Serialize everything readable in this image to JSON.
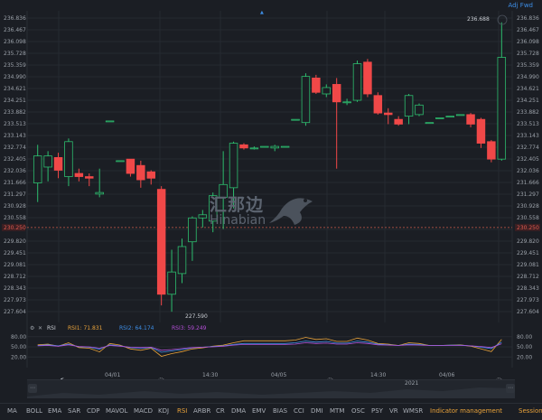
{
  "header": {
    "adj_label": "Adj Fwd",
    "marker_icon": "triangle-marker-icon"
  },
  "chart_data": {
    "type": "candlestick",
    "price_axis": {
      "min": 227.604,
      "max": 236.836,
      "ticks": [
        236.836,
        236.467,
        236.098,
        235.728,
        235.359,
        234.99,
        234.621,
        234.251,
        233.882,
        233.513,
        233.143,
        232.774,
        232.405,
        232.036,
        231.666,
        231.297,
        230.928,
        230.558,
        230.189,
        229.82,
        229.451,
        229.081,
        228.712,
        228.343,
        227.973,
        227.604
      ],
      "left_labels": [
        "236.836",
        "236.467",
        "236.098",
        "235.728",
        "235.359",
        "234.990",
        "234.621",
        "234.251",
        "233.882",
        "233.513",
        "233.143",
        "232.774",
        "232.405",
        "232.036",
        "231.666",
        "231.297",
        "230.928",
        "230.558",
        "",
        "229.820",
        "229.451",
        "229.081",
        "228.712",
        "228.343",
        "227.973",
        "227.604"
      ],
      "right_labels": [
        "236.836",
        "236.467",
        "236.098",
        "235.728",
        "235.359",
        "234.990",
        "234.621",
        "234.251",
        "233.882",
        "233.513",
        "233.143",
        "232.774",
        "232.405",
        "232.036",
        "231.666",
        "231.297",
        "230.928",
        "230.558",
        "",
        "229.820",
        "229.451",
        "229.081",
        "228.712",
        "228.343",
        "227.973",
        "227.604"
      ],
      "current_price": 230.25,
      "current_label": "230.250",
      "high_label": "236.688",
      "low_label": "227.590"
    },
    "candles": [
      {
        "o": 231.65,
        "h": 232.85,
        "l": 231.05,
        "c": 232.5
      },
      {
        "o": 232.15,
        "h": 232.65,
        "l": 231.7,
        "c": 232.5
      },
      {
        "o": 232.45,
        "h": 232.6,
        "l": 231.8,
        "c": 232.05
      },
      {
        "o": 231.85,
        "h": 233.05,
        "l": 231.55,
        "c": 232.95
      },
      {
        "o": 231.95,
        "h": 232.1,
        "l": 231.7,
        "c": 231.85
      },
      {
        "o": 231.85,
        "h": 231.95,
        "l": 231.55,
        "c": 231.8
      },
      {
        "o": 231.3,
        "h": 232.1,
        "l": 231.2,
        "c": 231.35
      },
      {
        "o": 233.6,
        "h": 233.6,
        "l": 233.6,
        "c": 233.6
      },
      {
        "o": 232.35,
        "h": 232.35,
        "l": 232.35,
        "c": 232.35
      },
      {
        "o": 232.4,
        "h": 232.4,
        "l": 231.85,
        "c": 231.95
      },
      {
        "o": 232.2,
        "h": 232.35,
        "l": 231.5,
        "c": 231.75
      },
      {
        "o": 232.0,
        "h": 232.05,
        "l": 231.6,
        "c": 231.8
      },
      {
        "o": 231.45,
        "h": 231.55,
        "l": 227.8,
        "c": 228.15
      },
      {
        "o": 228.15,
        "h": 229.55,
        "l": 227.6,
        "c": 228.85
      },
      {
        "o": 228.8,
        "h": 229.9,
        "l": 228.5,
        "c": 229.65
      },
      {
        "o": 229.8,
        "h": 230.6,
        "l": 229.2,
        "c": 230.55
      },
      {
        "o": 230.55,
        "h": 230.8,
        "l": 230.25,
        "c": 230.65
      },
      {
        "o": 230.45,
        "h": 231.35,
        "l": 230.1,
        "c": 231.25
      },
      {
        "o": 231.2,
        "h": 232.65,
        "l": 230.2,
        "c": 231.6
      },
      {
        "o": 231.5,
        "h": 232.95,
        "l": 230.85,
        "c": 232.9
      },
      {
        "o": 232.85,
        "h": 232.9,
        "l": 232.7,
        "c": 232.75
      },
      {
        "o": 232.75,
        "h": 232.8,
        "l": 232.7,
        "c": 232.75
      },
      {
        "o": 232.8,
        "h": 232.8,
        "l": 232.8,
        "c": 232.8
      },
      {
        "o": 232.75,
        "h": 232.85,
        "l": 232.65,
        "c": 232.8
      },
      {
        "o": 232.8,
        "h": 232.8,
        "l": 232.8,
        "c": 232.8
      },
      {
        "o": 233.65,
        "h": 233.65,
        "l": 233.65,
        "c": 233.65
      },
      {
        "o": 233.55,
        "h": 235.1,
        "l": 233.45,
        "c": 235.0
      },
      {
        "o": 234.95,
        "h": 235.05,
        "l": 234.45,
        "c": 234.5
      },
      {
        "o": 234.45,
        "h": 234.75,
        "l": 234.35,
        "c": 234.65
      },
      {
        "o": 234.75,
        "h": 234.95,
        "l": 232.1,
        "c": 234.2
      },
      {
        "o": 234.2,
        "h": 234.3,
        "l": 234.1,
        "c": 234.2
      },
      {
        "o": 234.25,
        "h": 235.5,
        "l": 234.2,
        "c": 235.4
      },
      {
        "o": 235.45,
        "h": 235.55,
        "l": 234.35,
        "c": 234.45
      },
      {
        "o": 234.4,
        "h": 234.5,
        "l": 233.8,
        "c": 233.85
      },
      {
        "o": 233.85,
        "h": 234.0,
        "l": 233.5,
        "c": 233.8
      },
      {
        "o": 233.65,
        "h": 233.75,
        "l": 233.45,
        "c": 233.5
      },
      {
        "o": 233.75,
        "h": 234.45,
        "l": 233.5,
        "c": 234.4
      },
      {
        "o": 233.8,
        "h": 234.15,
        "l": 233.75,
        "c": 234.1
      },
      {
        "o": 233.55,
        "h": 233.55,
        "l": 233.55,
        "c": 233.55
      },
      {
        "o": 233.7,
        "h": 233.7,
        "l": 233.7,
        "c": 233.7
      },
      {
        "o": 233.75,
        "h": 233.75,
        "l": 233.75,
        "c": 233.75
      },
      {
        "o": 233.8,
        "h": 233.8,
        "l": 233.8,
        "c": 233.8
      },
      {
        "o": 233.8,
        "h": 233.85,
        "l": 233.4,
        "c": 233.5
      },
      {
        "o": 233.65,
        "h": 233.7,
        "l": 232.75,
        "c": 232.9
      },
      {
        "o": 232.95,
        "h": 233.0,
        "l": 232.3,
        "c": 232.4
      },
      {
        "o": 232.4,
        "h": 236.7,
        "l": 232.35,
        "c": 235.6
      }
    ],
    "rsi": {
      "label": "RSI",
      "series": [
        {
          "name": "RSI1: 71.831",
          "color": "#e8a23a",
          "values": [
            56,
            58,
            52,
            62,
            48,
            46,
            35,
            60,
            55,
            44,
            40,
            46,
            22,
            30,
            36,
            44,
            47,
            52,
            55,
            62,
            68,
            68,
            68,
            68,
            68,
            70,
            78,
            72,
            74,
            66,
            66,
            76,
            70,
            60,
            58,
            54,
            62,
            60,
            54,
            54,
            55,
            56,
            52,
            44,
            36,
            72
          ]
        },
        {
          "name": "RSI2: 64.174",
          "color": "#3d8ee6",
          "values": [
            54,
            56,
            53,
            58,
            50,
            49,
            43,
            56,
            53,
            48,
            46,
            48,
            34,
            38,
            42,
            47,
            49,
            51,
            53,
            57,
            60,
            60,
            60,
            60,
            60,
            62,
            67,
            64,
            66,
            61,
            61,
            67,
            64,
            58,
            56,
            54,
            58,
            57,
            54,
            54,
            55,
            55,
            53,
            49,
            45,
            64
          ]
        },
        {
          "name": "RSI3: 59.249",
          "color": "#b34fd6",
          "values": [
            53,
            54,
            52,
            56,
            51,
            50,
            46,
            54,
            52,
            49,
            48,
            49,
            40,
            42,
            45,
            48,
            49,
            50,
            52,
            55,
            57,
            57,
            57,
            57,
            57,
            58,
            62,
            60,
            61,
            58,
            58,
            62,
            60,
            56,
            55,
            54,
            56,
            55,
            54,
            54,
            54,
            54,
            53,
            51,
            48,
            59
          ]
        }
      ],
      "axis_labels": [
        "80.00",
        "50.00",
        "20.00"
      ],
      "axis_values": [
        80,
        50,
        20
      ]
    },
    "time_labels": [
      "04/01",
      "14:30",
      "04/05",
      "14:30",
      "04/06"
    ],
    "nav_year": "2021"
  },
  "indicators": [
    "MA",
    "BOLL",
    "EMA",
    "SAR",
    "CDP",
    "MAVOL",
    "MACD",
    "KDJ",
    "RSI",
    "ARBR",
    "CR",
    "DMA",
    "EMV",
    "BIAS",
    "CCI",
    "DMI",
    "MTM",
    "OSC",
    "PSY",
    "VR",
    "WMSR",
    "Indicator management",
    "Session"
  ],
  "active_indicator": "RSI",
  "watermark": {
    "cn": "汇那边",
    "en": "Hinabian"
  },
  "colors": {
    "up": "#2dbd6e",
    "down": "#f04848",
    "grid": "#262a31",
    "current_line": "#c85a4a"
  }
}
